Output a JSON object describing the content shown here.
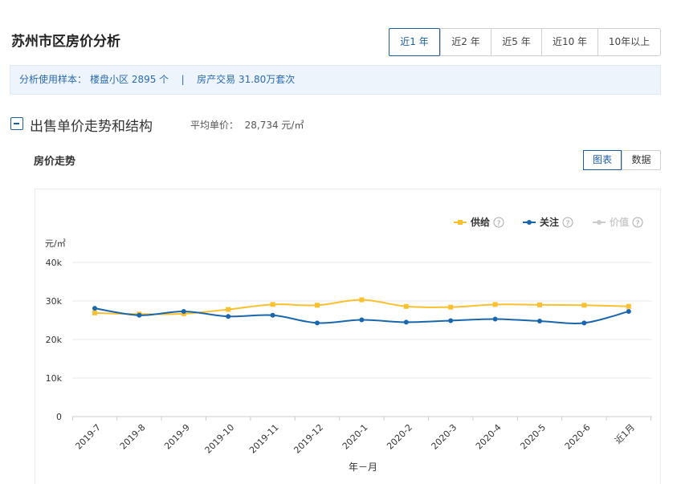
{
  "header": {
    "title": "苏州市区房价分析",
    "range_options": [
      "近1 年",
      "近2 年",
      "近5 年",
      "近10 年",
      "10年以上"
    ],
    "active_range": 0
  },
  "sample": {
    "label": "分析使用样本：",
    "estates": "楼盘小区 2895 个",
    "separator": "|",
    "transactions": "房产交易 31.80万套次"
  },
  "section": {
    "title": "出售单价走势和结构",
    "avg_price": "平均单价：  28,734 元/㎡"
  },
  "trend": {
    "title": "房价走势",
    "view_options": [
      "图表",
      "数据"
    ],
    "active_view": 0
  },
  "legend": [
    {
      "label": "供给",
      "help": "?",
      "color": "#fbc02d",
      "marker": "square"
    },
    {
      "label": "关注",
      "help": "?",
      "color": "#1a66ad",
      "marker": "circle"
    },
    {
      "label": "价值",
      "help": "?",
      "color": "#cccccc",
      "marker": "circle"
    }
  ],
  "chart_data": {
    "type": "line",
    "xlabel": "年－月",
    "ylabel": "元/㎡",
    "ylim": [
      0,
      40000
    ],
    "yticks": [
      "0",
      "10k",
      "20k",
      "30k",
      "40k"
    ],
    "categories": [
      "2019-7",
      "2019-8",
      "2019-9",
      "2019-10",
      "2019-11",
      "2019-12",
      "2020-1",
      "2020-2",
      "2020-3",
      "2020-4",
      "2020-5",
      "2020-6",
      "近1月"
    ],
    "series": [
      {
        "name": "供给",
        "color": "#fbc02d",
        "values": [
          26900,
          26600,
          26700,
          27800,
          29100,
          28900,
          30300,
          28600,
          28400,
          29100,
          29000,
          28900,
          28600
        ]
      },
      {
        "name": "关注",
        "color": "#1a66ad",
        "values": [
          28100,
          26300,
          27300,
          26000,
          26300,
          24300,
          25100,
          24500,
          24900,
          25300,
          24800,
          24300,
          27300
        ]
      },
      {
        "name": "价值",
        "color": "#cccccc",
        "values": []
      }
    ],
    "grid": true,
    "legend_position": "top-right"
  }
}
